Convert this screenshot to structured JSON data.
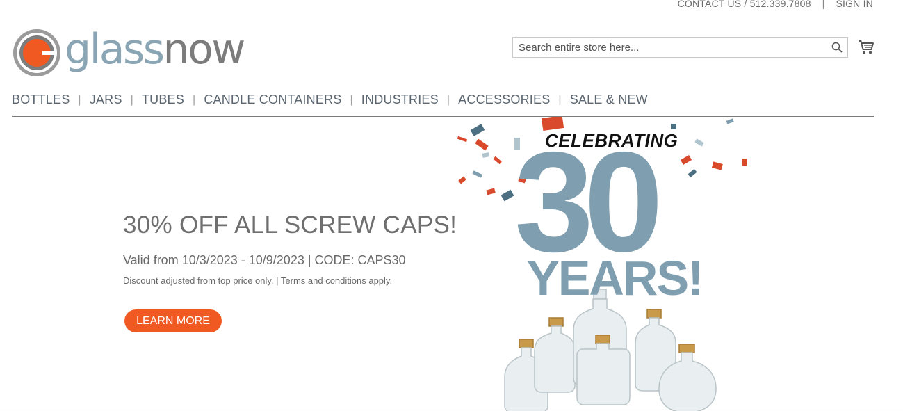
{
  "topbar": {
    "contact": "CONTACT US / 512.339.7808",
    "divider": "|",
    "sign_in": "SIGN IN"
  },
  "logo": {
    "part1": "glass",
    "part2": "now",
    "color_accent": "#f05a22",
    "color_blue": "#8aa5b4",
    "color_gray": "#7c7c7c"
  },
  "search": {
    "placeholder": "Search entire store here...",
    "icon": "search-icon"
  },
  "cart": {
    "icon": "cart-icon"
  },
  "nav": {
    "items": [
      "BOTTLES",
      "JARS",
      "TUBES",
      "CANDLE CONTAINERS",
      "INDUSTRIES",
      "ACCESSORIES",
      "SALE & NEW"
    ],
    "separator": "|"
  },
  "promo": {
    "headline": "30% OFF ALL SCREW CAPS!",
    "valid": "Valid from 10/3/2023 - 10/9/2023 | CODE: CAPS30",
    "fine_print": "Discount adjusted from top price only. | Terms and conditions apply.",
    "button": "LEARN MORE",
    "button_color": "#f05a22"
  },
  "hero": {
    "celebrating": "CELEBRATING",
    "number": "30",
    "years": "YEARS!",
    "number_color": "#7f9fb0"
  }
}
